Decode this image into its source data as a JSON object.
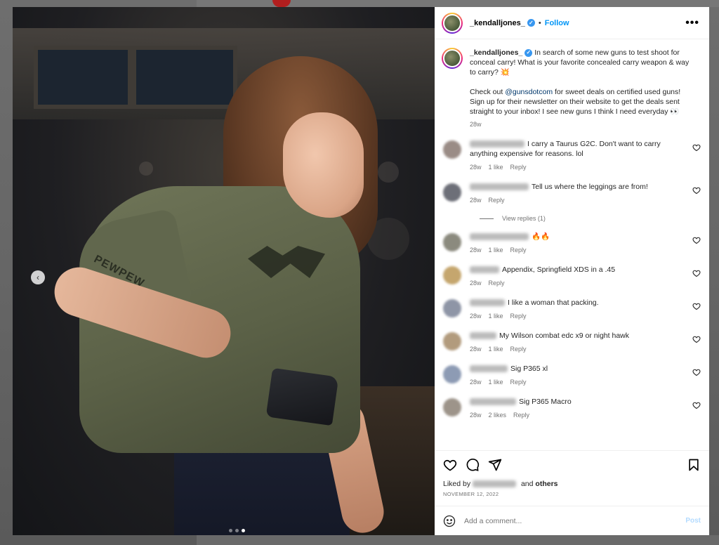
{
  "post": {
    "username": "_kendalljones_",
    "follow_label": "Follow",
    "separator": "•",
    "more_label": "•••",
    "caption": {
      "line1": "In search of some new guns to test shoot for conceal carry! What is your favorite concealed carry weapon & way to carry? 💥",
      "line2_prefix": "Check out ",
      "mention": "@gunsdotcom",
      "line2_suffix": " for sweet deals on certified used guns! Sign up for their newsletter on their website to get the deals sent straight to your inbox! I see new guns I think I need everyday 👀",
      "time": "28w"
    },
    "sleeve_text": "PEWPEW"
  },
  "comments": [
    {
      "text": "I carry a Taurus G2C. Don't want to carry anything expensive for reasons. lol",
      "time": "28w",
      "likes": "1 like",
      "reply": "Reply",
      "avatar_color": "#9a8c86",
      "name_width": 78
    },
    {
      "text": "Tell us where the leggings are from!",
      "time": "28w",
      "likes": "",
      "reply": "Reply",
      "avatar_color": "#6d6f78",
      "name_width": 84,
      "view_replies": "View replies (1)"
    },
    {
      "text": "🔥🔥",
      "time": "28w",
      "likes": "1 like",
      "reply": "Reply",
      "avatar_color": "#8b8a7e",
      "name_width": 84
    },
    {
      "text": "Appendix, Springfield XDS in a .45",
      "time": "28w",
      "likes": "",
      "reply": "Reply",
      "avatar_color": "#c5a66e",
      "name_width": 42
    },
    {
      "text": "I like a woman that packing.",
      "time": "28w",
      "likes": "1 like",
      "reply": "Reply",
      "avatar_color": "#8e95a6",
      "name_width": 50
    },
    {
      "text": "My Wilson combat edc x9 or night hawk",
      "time": "28w",
      "likes": "1 like",
      "reply": "Reply",
      "avatar_color": "#b29b7d",
      "name_width": 38
    },
    {
      "text": "Sig P365 xl",
      "time": "28w",
      "likes": "1 like",
      "reply": "Reply",
      "avatar_color": "#8d9bb4",
      "name_width": 54
    },
    {
      "text": "Sig P365 Macro",
      "time": "28w",
      "likes": "2 likes",
      "reply": "Reply",
      "avatar_color": "#9d948a",
      "name_width": 66
    }
  ],
  "footer": {
    "liked_by_prefix": "Liked by",
    "liked_by_and": "and",
    "liked_by_others": "others",
    "date": "NOVEMBER 12, 2022",
    "comment_placeholder": "Add a comment...",
    "post_label": "Post"
  },
  "icons": {
    "nav_prev": "‹"
  }
}
